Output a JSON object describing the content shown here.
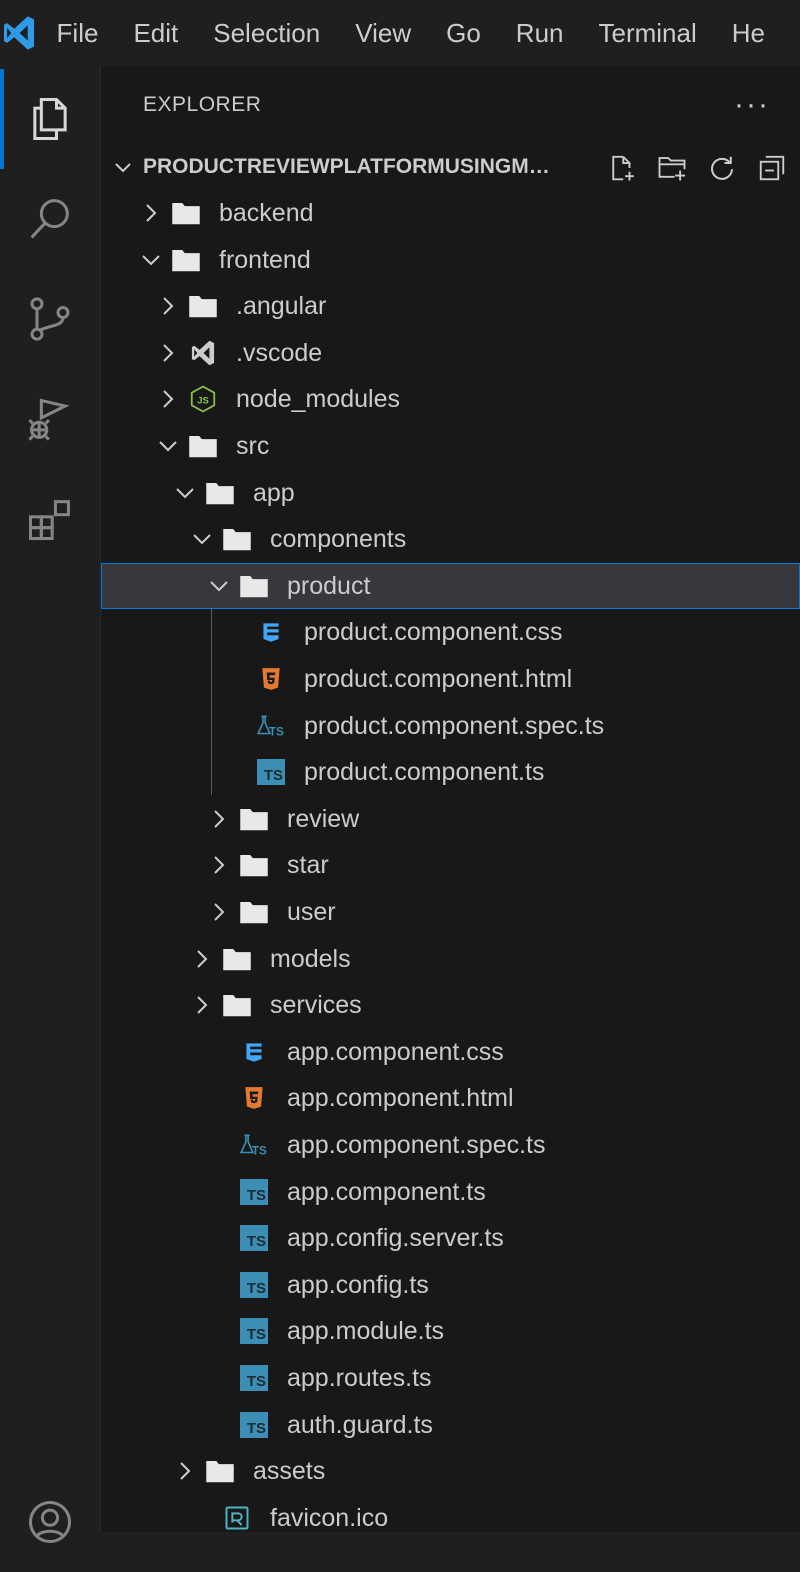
{
  "menubar": {
    "items": [
      "File",
      "Edit",
      "Selection",
      "View",
      "Go",
      "Run",
      "Terminal",
      "He"
    ]
  },
  "sidebar": {
    "title": "EXPLORER",
    "more": "···",
    "root": "PRODUCTREVIEWPLATFORMUSINGME..."
  },
  "tree": [
    {
      "label": "backend",
      "depth": 0,
      "type": "folder",
      "expanded": false
    },
    {
      "label": "frontend",
      "depth": 0,
      "type": "folder",
      "expanded": true
    },
    {
      "label": ".angular",
      "depth": 1,
      "type": "folder",
      "expanded": false
    },
    {
      "label": ".vscode",
      "depth": 1,
      "type": "vscode-folder",
      "expanded": false
    },
    {
      "label": "node_modules",
      "depth": 1,
      "type": "node-folder",
      "expanded": false
    },
    {
      "label": "src",
      "depth": 1,
      "type": "folder",
      "expanded": true
    },
    {
      "label": "app",
      "depth": 2,
      "type": "folder",
      "expanded": true
    },
    {
      "label": "components",
      "depth": 3,
      "type": "folder",
      "expanded": true
    },
    {
      "label": "product",
      "depth": 4,
      "type": "folder",
      "expanded": true,
      "selected": true
    },
    {
      "label": "product.component.css",
      "depth": 5,
      "type": "css"
    },
    {
      "label": "product.component.html",
      "depth": 5,
      "type": "html"
    },
    {
      "label": "product.component.spec.ts",
      "depth": 5,
      "type": "spec"
    },
    {
      "label": "product.component.ts",
      "depth": 5,
      "type": "ts"
    },
    {
      "label": "review",
      "depth": 4,
      "type": "folder",
      "expanded": false
    },
    {
      "label": "star",
      "depth": 4,
      "type": "folder",
      "expanded": false
    },
    {
      "label": "user",
      "depth": 4,
      "type": "folder",
      "expanded": false
    },
    {
      "label": "models",
      "depth": 3,
      "type": "folder",
      "expanded": false
    },
    {
      "label": "services",
      "depth": 3,
      "type": "folder",
      "expanded": false
    },
    {
      "label": "app.component.css",
      "depth": 4,
      "type": "css"
    },
    {
      "label": "app.component.html",
      "depth": 4,
      "type": "html"
    },
    {
      "label": "app.component.spec.ts",
      "depth": 4,
      "type": "spec"
    },
    {
      "label": "app.component.ts",
      "depth": 4,
      "type": "ts"
    },
    {
      "label": "app.config.server.ts",
      "depth": 4,
      "type": "ts"
    },
    {
      "label": "app.config.ts",
      "depth": 4,
      "type": "ts"
    },
    {
      "label": "app.module.ts",
      "depth": 4,
      "type": "ts"
    },
    {
      "label": "app.routes.ts",
      "depth": 4,
      "type": "ts"
    },
    {
      "label": "auth.guard.ts",
      "depth": 4,
      "type": "ts"
    },
    {
      "label": "assets",
      "depth": 2,
      "type": "folder",
      "expanded": false
    },
    {
      "label": "favicon.ico",
      "depth": 3,
      "type": "image"
    }
  ],
  "icons": {
    "ts_badge_text": "TS",
    "spec_badge_text": "TS",
    "colors": {
      "accent": "#0078d4",
      "ts": "#3d8eb5",
      "css": "#42a5f5",
      "html": "#e37933",
      "node": "#8bc34a",
      "vscode": "#cccccc"
    }
  }
}
